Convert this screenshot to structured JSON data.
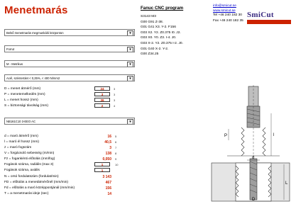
{
  "title": "Menetmarás",
  "selects": [
    {
      "value": "Belső menetmarás megmunkáló központon"
    },
    {
      "value": "Forrut"
    },
    {
      "value": "M - Metrikus"
    },
    {
      "value": "Acél, szénterület < 0,25%, < 400 N/mm2"
    },
    {
      "value": "NB161C10 3-EEO AC"
    }
  ],
  "params_top": [
    {
      "label": "D = menet átmérő (mm)",
      "value": "24",
      "idx": "3"
    },
    {
      "label": "P = menetemelkedés (mm)",
      "value": "3",
      "idx": "3"
    },
    {
      "label": "L = menet hossz (mm)",
      "value": "36",
      "idx": "3"
    },
    {
      "label": "S = biztonsági távolság (mm)",
      "value": "2",
      "idx": "4"
    }
  ],
  "params_bottom": [
    {
      "label": "d = maró átmérő (mm)",
      "value": "16",
      "idx": "5"
    },
    {
      "label": "l = maró él hossz (mm)",
      "value": "40,5",
      "idx": "6"
    },
    {
      "label": "z = maró fogszám",
      "value": "3",
      "idx": "7"
    },
    {
      "label": "V = forgácsoló sebesség (m/min)",
      "value": "138",
      "idx": "8"
    },
    {
      "label": "Fz = fogankénti előtolás (mm/fog)",
      "value": "0,050",
      "idx": "9"
    },
    {
      "label": "Fogások száma, radiális (max 3)",
      "value": "1",
      "idx": "10"
    },
    {
      "label": "Fogások száma, axiális",
      "value": "1",
      "idx": ""
    }
  ],
  "results": [
    {
      "label": "N = orsó fordulatszám (fordulat/min)",
      "value": "3 143"
    },
    {
      "label": "FD = előtolás a menetátmérőnél (mm/min)",
      "value": "467"
    },
    {
      "label": "Fd = előtolás a maró középpontjánál (mm/min)",
      "value": "156"
    },
    {
      "label": "T = a menetmarás ideje (sec)",
      "value": "14"
    }
  ],
  "cnc": {
    "heading": "Fanuc CNC program",
    "lines": [
      "S3143 M3",
      "G00 G91 Z-38.",
      "G01 G41 X3. Y-2. F156",
      "G03 X2. Y2. Z0.375 I0. J2.",
      "G03 X0. Y0. Z3. I-4. J0.",
      "G03 X-2. Y2. Z0.375 I-2. J0.",
      "G01 G40 X-2. Y-2.",
      "G00 Z34.25"
    ]
  },
  "contact": {
    "email": "info@smicut.se",
    "web": "www.smicut.se",
    "tel": "Tel +46 240 182 30",
    "fax": "Fax +46 240 182 35"
  },
  "logo": {
    "brand": "SmiCut"
  },
  "drawing_labels": {
    "p": "P",
    "l": "l",
    "d_small": "d",
    "d_large": "D",
    "L": "L"
  },
  "colors": {
    "accent": "#cc2200",
    "brand": "#3a2a80"
  }
}
